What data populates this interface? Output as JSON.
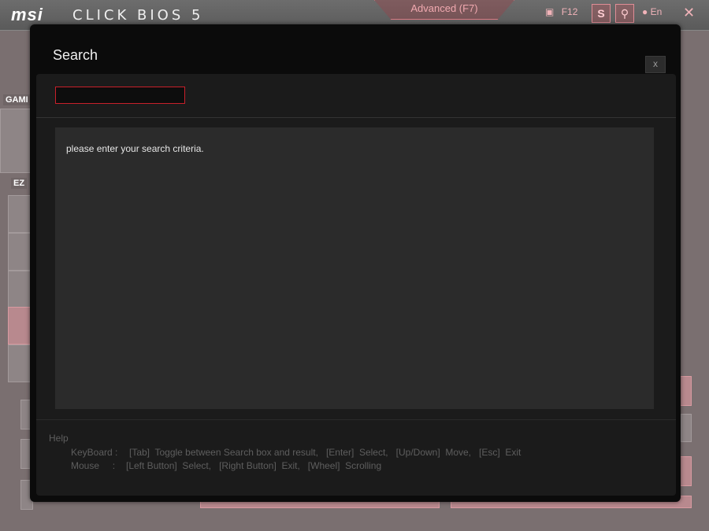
{
  "topbar": {
    "logo": "msi",
    "product": "CLICK BIOS 5",
    "mode_tab": "Advanced (F7)",
    "screenshot_key": "F12",
    "lang": "En"
  },
  "background": {
    "sidebar_label": "GAMI",
    "ez_label": "EZ"
  },
  "dialog": {
    "title": "Search",
    "close_label": "x",
    "search": {
      "value": "",
      "placeholder": ""
    },
    "results_message": "please enter your search criteria.",
    "help": {
      "title": "Help",
      "keyboard_label": "KeyBoard :",
      "keyboard_text": "[Tab]  Toggle between Search box and result,   [Enter]  Select,   [Up/Down]  Move,   [Esc]  Exit",
      "mouse_label": "Mouse     :",
      "mouse_text": "[Left Button]  Select,   [Right Button]  Exit,   [Wheel]  Scrolling"
    }
  },
  "colors": {
    "accent_red": "#c8202a",
    "dialog_bg": "#0b0b0b",
    "inner_bg": "#1b1b1b",
    "results_bg": "#2b2b2b"
  }
}
